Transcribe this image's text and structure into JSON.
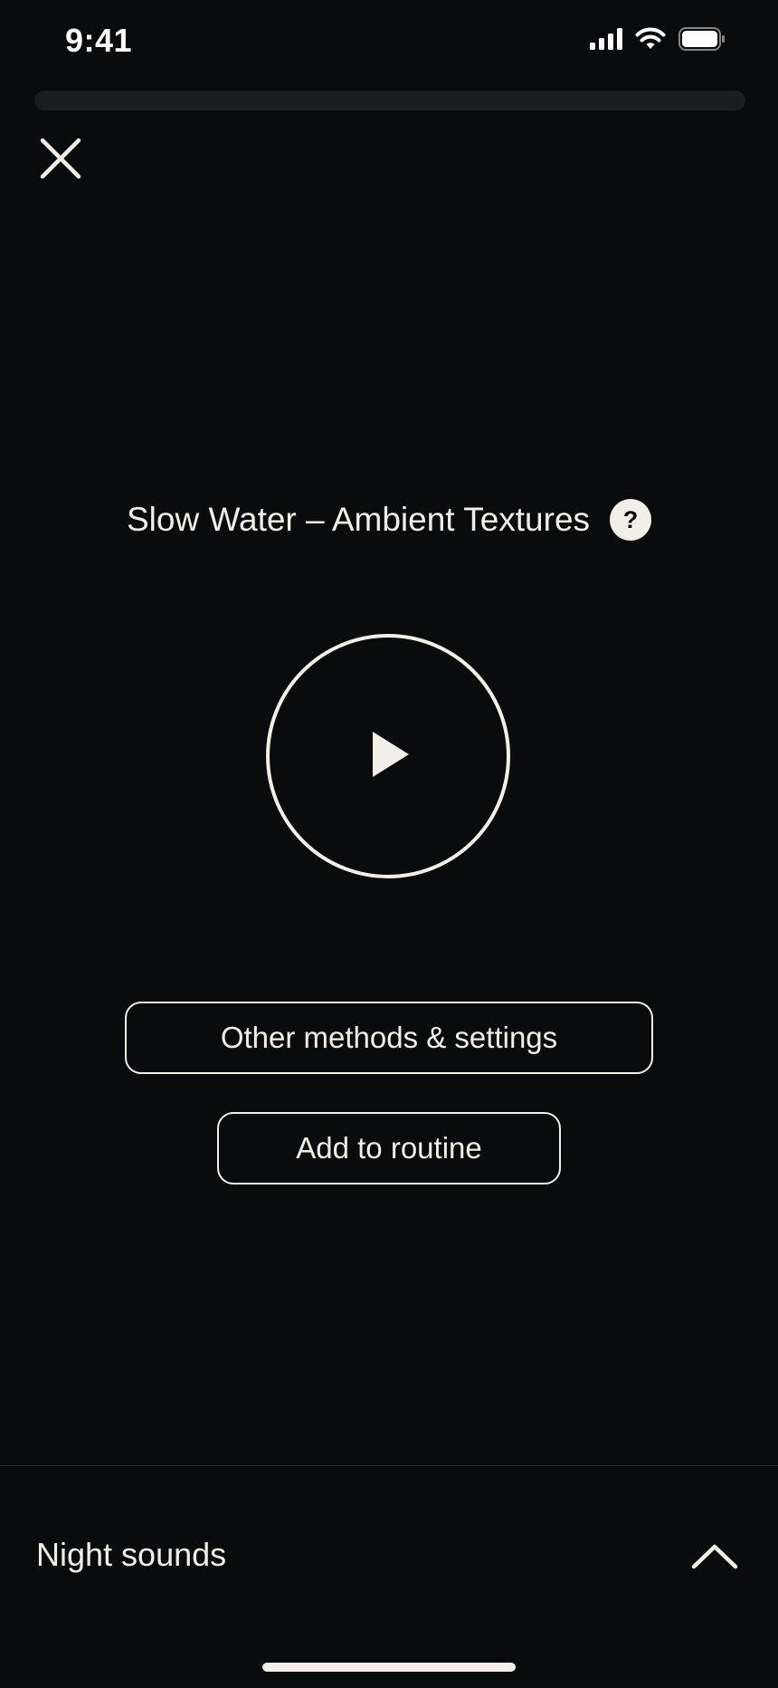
{
  "status_bar": {
    "time": "9:41",
    "icons": [
      "cellular-signal-icon",
      "wifi-icon",
      "battery-icon"
    ]
  },
  "session": {
    "progress_fraction": 0.0
  },
  "header": {
    "close_icon": "close-icon"
  },
  "track": {
    "title": "Slow Water – Ambient Textures",
    "help_label": "?"
  },
  "player": {
    "play_icon": "play-icon"
  },
  "actions": {
    "other_methods_label": "Other methods & settings",
    "add_to_routine_label": "Add to routine"
  },
  "bottom_sheet": {
    "title": "Night sounds",
    "expand_icon": "chevron-up-icon"
  },
  "colors": {
    "background": "#0a0b0c",
    "foreground": "#f2efe9",
    "track": "#1c1d1f"
  }
}
